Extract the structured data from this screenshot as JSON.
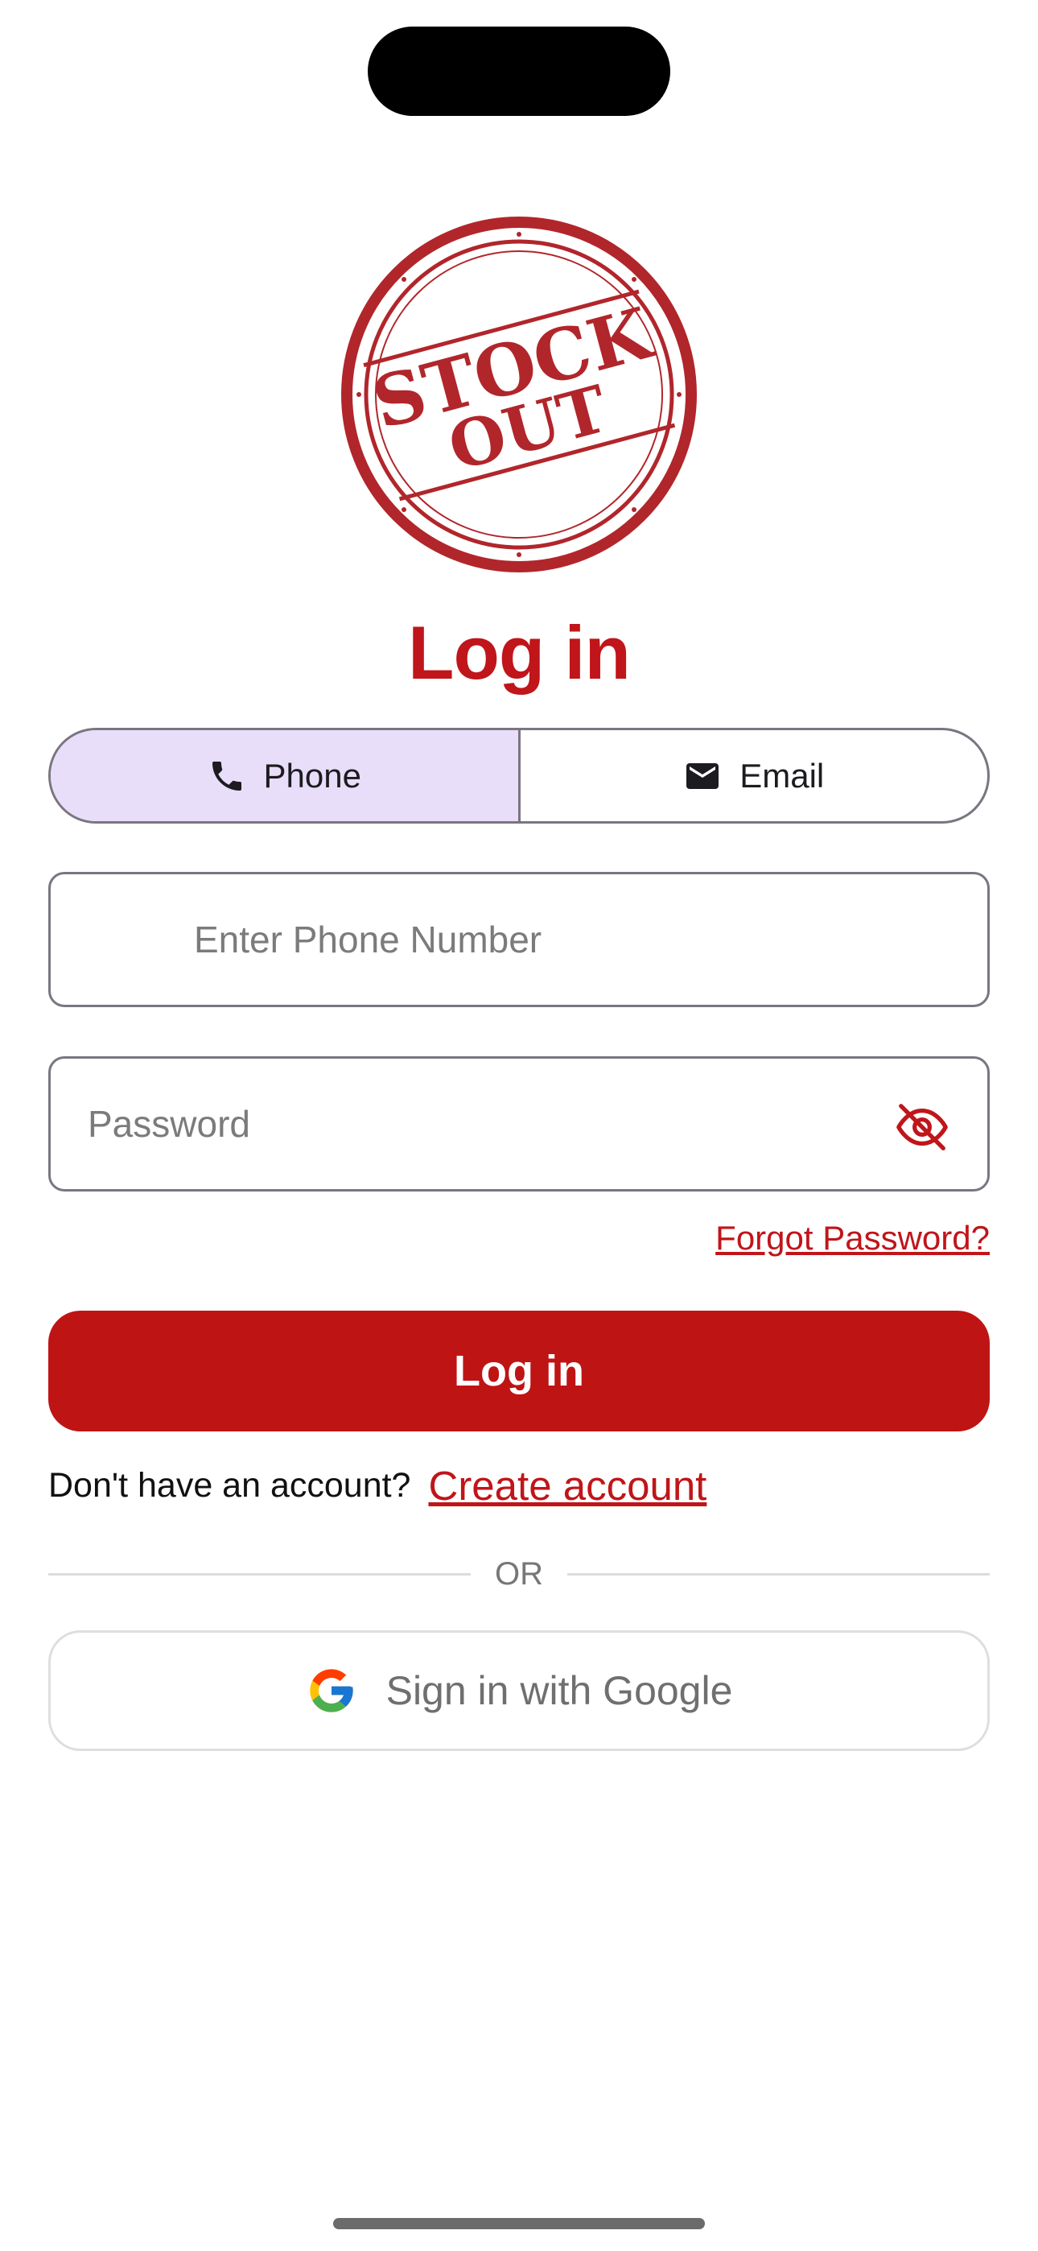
{
  "logo": {
    "line1": "STOCK",
    "line2": "OUT",
    "color": "#b1262b"
  },
  "title": "Log in",
  "tabs": [
    {
      "label": "Phone",
      "icon": "phone-icon",
      "active": true
    },
    {
      "label": "Email",
      "icon": "mail-icon",
      "active": false
    }
  ],
  "phone_field": {
    "placeholder": "Enter Phone Number",
    "value": ""
  },
  "password_field": {
    "placeholder": "Password",
    "value": "",
    "toggle_icon": "eye-off-icon"
  },
  "forgot_password": "Forgot Password?",
  "login_button": "Log in",
  "signup": {
    "prompt": "Don't have an account?",
    "link": "Create account"
  },
  "divider": "OR",
  "google_button": {
    "label": "Sign in with Google",
    "icon": "google-icon"
  },
  "colors": {
    "brand": "#c0151a",
    "active_tab": "#e8defa",
    "button": "#bf1414"
  }
}
